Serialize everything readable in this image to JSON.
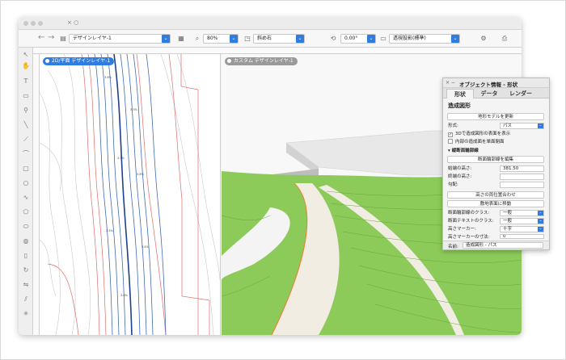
{
  "window": {
    "tab_close": "× ○",
    "nav_back": "←",
    "nav_forward": "→"
  },
  "toolbar": {
    "layer_label": "デザインレイヤ-1",
    "zoom_value": "80%",
    "view_label": "斜め右",
    "angle_value": "0.00°",
    "render_label": "透視投影(標準)",
    "colors": {
      "accent": "#2f7de1"
    }
  },
  "toolstrip": {
    "tools": [
      "arrow-icon",
      "pan-icon",
      "text-icon",
      "rectangle-icon",
      "pin-icon",
      "line-icon",
      "polyline-icon",
      "arc-icon",
      "rectangle-icon",
      "circle-icon",
      "freehand-icon",
      "polygon-icon",
      "oval-icon",
      "spiral-icon",
      "wall-icon",
      "rotate-icon",
      "mirror-icon"
    ]
  },
  "plan_view": {
    "label": "2D/平面  デザインレイヤ-1"
  },
  "scene_view": {
    "label": "カスタム  デザインレイヤ-1"
  },
  "oip": {
    "close": "×  −",
    "title": "オブジェクト情報 - 形状",
    "tabs": [
      "形状",
      "データ",
      "レンダー"
    ],
    "object_type": "造成図形",
    "update_button": "地形モデルを更新",
    "format_label": "形式:",
    "format_value": "パス",
    "check1": "3Dで造成図形の表面を表示",
    "check2": "内部の造成面を単面閉面",
    "section_title": "縦断面輪郭線",
    "edit_button": "断面輪郭線を編集",
    "start_height_label": "始端の高さ:",
    "start_height_value": "381.50",
    "end_height_label": "終端の高さ:",
    "end_height_value": "",
    "slope_label": "勾配:",
    "slope_value": "",
    "fit_button": "高さの両位置合わせ",
    "move_button": "敷地表面に移動",
    "class1_label": "断面輪郭線のクラス:",
    "class1_value": "一般",
    "class2_label": "断面テキストのクラス:",
    "class2_value": "一般",
    "marker_label": "高さマーカー:",
    "marker_value": "十字",
    "marker_size_label": "高さマーカーの寸法:",
    "marker_size_value": "0",
    "name_label": "名前:",
    "name_value": "造成図形 - パス"
  }
}
